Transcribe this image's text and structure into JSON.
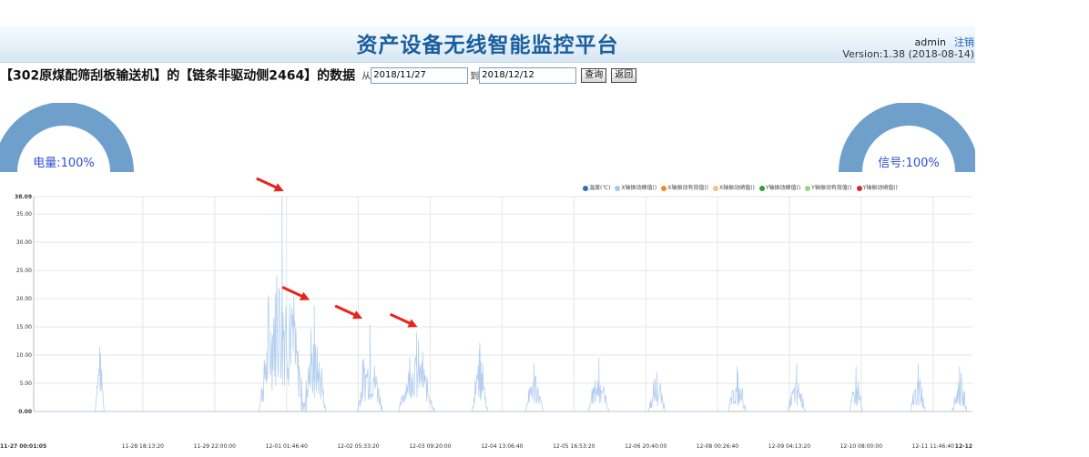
{
  "header": {
    "title": "资产设备无线智能监控平台",
    "user": "admin",
    "logout_label": "注销",
    "version": "Version:1.38 (2018-08-14)"
  },
  "query": {
    "heading": "【302原煤配筛刮板输送机】的【链条非驱动侧2464】的数据",
    "from_label": "从",
    "from_date": "2018/11/27",
    "to_label": "到",
    "to_date": "2018/12/12",
    "search_label": "查询",
    "back_label": "返回"
  },
  "gauges": {
    "battery": {
      "label": "电量:100%",
      "value": 100
    },
    "signal": {
      "label": "信号:100%",
      "value": 100
    }
  },
  "colors": {
    "gauge": "#6fa0cc",
    "series": "#b5cff0",
    "grid": "#e6e6e6",
    "arrow": "#e8241c",
    "title": "#1a5f9d"
  },
  "legend": [
    {
      "name": "温度(℃)",
      "color": "#2f6fb5"
    },
    {
      "name": "X轴振动峰值()",
      "color": "#a9c4ea"
    },
    {
      "name": "X轴振动有效值()",
      "color": "#f08a26"
    },
    {
      "name": "X轴振动峭值()",
      "color": "#f7be85"
    },
    {
      "name": "Y轴振动峰值()",
      "color": "#2f9e3a"
    },
    {
      "name": "Y轴振动有效值()",
      "color": "#98d67e"
    },
    {
      "name": "Y轴振动峭值()",
      "color": "#d32a2a"
    }
  ],
  "chart_data": {
    "type": "line",
    "y_tick_labels": [
      "0.00",
      "5.00",
      "10.00",
      "15.00",
      "20.00",
      "25.00",
      "30.00",
      "35.00",
      "38.09"
    ],
    "y_ticks": [
      0,
      5,
      10,
      15,
      20,
      25,
      30,
      35,
      38.09
    ],
    "ylim": [
      0,
      38.09
    ],
    "x_tick_labels": [
      "11-27 00:01:05",
      "11-28 18:13:20",
      "11-29 22:00:00",
      "12-01 01:46:40",
      "12-02 05:33:20",
      "12-03 09:20:00",
      "12-04 13:06:40",
      "12-05 16:53:20",
      "12-06 20:40:00",
      "12-08 00:26:40",
      "12-09 04:13:20",
      "12-10 08:00:00",
      "12-11 11:46:40",
      "12-12"
    ],
    "x_ticks_hours": [
      0,
      42.2,
      70,
      97.8,
      125.5,
      153.3,
      181.1,
      208.9,
      236.7,
      264.4,
      292.2,
      320,
      347.8,
      363
    ],
    "xlim_hours": [
      0,
      363
    ],
    "annotated_peaks": [
      {
        "x_hours": 97.8,
        "y": 38.09
      },
      {
        "x_hours": 107.8,
        "y": 18.8
      },
      {
        "x_hours": 128.2,
        "y": 15.5
      },
      {
        "x_hours": 149.5,
        "y": 14
      }
    ],
    "bursts": [
      {
        "center_hours": 25.5,
        "width_hours": 3.5,
        "peak": 11.5,
        "base": 3.5
      },
      {
        "center_hours": 96.0,
        "width_hours": 18,
        "peak": 38.09,
        "base": 4.5
      },
      {
        "center_hours": 108.5,
        "width_hours": 9,
        "peak": 18.8,
        "base": 2.5
      },
      {
        "center_hours": 130.0,
        "width_hours": 10,
        "peak": 15.5,
        "base": 2.0
      },
      {
        "center_hours": 148.0,
        "width_hours": 14,
        "peak": 14.0,
        "base": 2.5
      },
      {
        "center_hours": 172.5,
        "width_hours": 6,
        "peak": 12.2,
        "base": 2.0
      },
      {
        "center_hours": 193.5,
        "width_hours": 7,
        "peak": 8.5,
        "base": 1.5
      },
      {
        "center_hours": 218.5,
        "width_hours": 8,
        "peak": 9.5,
        "base": 1.5
      },
      {
        "center_hours": 241.0,
        "width_hours": 7,
        "peak": 7.0,
        "base": 1.0
      },
      {
        "center_hours": 272.0,
        "width_hours": 7,
        "peak": 8.0,
        "base": 1.0
      },
      {
        "center_hours": 295.0,
        "width_hours": 7,
        "peak": 8.5,
        "base": 1.0
      },
      {
        "center_hours": 318.0,
        "width_hours": 5,
        "peak": 8.0,
        "base": 1.0
      },
      {
        "center_hours": 342.0,
        "width_hours": 6,
        "peak": 8.5,
        "base": 1.0
      },
      {
        "center_hours": 358.0,
        "width_hours": 6,
        "peak": 8.0,
        "base": 1.0
      }
    ]
  }
}
